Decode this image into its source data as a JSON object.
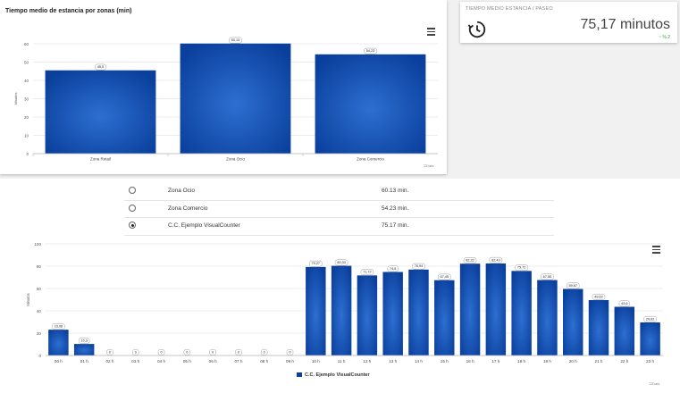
{
  "top_chart": {
    "title": "Tiempo medio de estancia por zonas (min)",
    "credits": "⎋Dats"
  },
  "kpi": {
    "title": "TIEMPO MEDIO ESTANCIA / PASEO",
    "value": "75,17 minutos",
    "change": "~ % 2",
    "icon": "clock-history-icon"
  },
  "selector": {
    "rows": [
      {
        "name": "Zona Ocio",
        "value": "60.13 min.",
        "checked": false
      },
      {
        "name": "Zona Comercio",
        "value": "54.23 min.",
        "checked": false
      },
      {
        "name": "C.C. Ejemplo VisualCounter",
        "value": "75.17 min.",
        "checked": true
      }
    ]
  },
  "bottom_chart": {
    "credits": "⎋Dats",
    "legend_label": "C.C. Ejemplo VisualCounter"
  },
  "colors": {
    "bar_edge": "#0a3f9c",
    "bar_center": "#2d6fd1",
    "grid": "#e6e6e6"
  },
  "chart_data": [
    {
      "type": "bar",
      "title": "Tiempo medio de estancia por zonas (min)",
      "ylabel": "Minutos",
      "categories": [
        "Zona Retail",
        "Zona Ocio",
        "Zona Comercio"
      ],
      "values": [
        45.5,
        60.13,
        54.23
      ],
      "data_labels": [
        "45,5",
        "60,13",
        "54,23"
      ],
      "ylim": [
        0,
        60
      ],
      "yticks": [
        0,
        10,
        20,
        30,
        40,
        50,
        60
      ],
      "grid": true
    },
    {
      "type": "bar",
      "ylabel": "Minutos",
      "categories": [
        "00 h",
        "01 h",
        "02 h",
        "03 h",
        "04 h",
        "05 h",
        "06 h",
        "07 h",
        "08 h",
        "09 h",
        "10 h",
        "11 h",
        "12 h",
        "13 h",
        "14 h",
        "15 h",
        "16 h",
        "17 h",
        "18 h",
        "19 h",
        "20 h",
        "21 h",
        "22 h",
        "23 h"
      ],
      "series": [
        {
          "name": "C.C. Ejemplo VisualCounter",
          "values": [
            23.08,
            10.3,
            0,
            0,
            0,
            0,
            0,
            0,
            0,
            0,
            79.27,
            80.33,
            71.72,
            74.8,
            76.94,
            67.45,
            82.22,
            82.43,
            75.72,
            67.55,
            59.57,
            49.62,
            43.6,
            29.62
          ],
          "data_labels": [
            "23,08",
            "10,3",
            "0",
            "0",
            "0",
            "0",
            "0",
            "0",
            "0",
            "0",
            "79,27",
            "80,33",
            "71,72",
            "74,8",
            "76,94",
            "67,45",
            "82,22",
            "82,43",
            "75,72",
            "67,55",
            "59,57",
            "49,62",
            "43,6",
            "29,62"
          ]
        }
      ],
      "ylim": [
        0,
        100
      ],
      "yticks": [
        0,
        20,
        40,
        60,
        80,
        100
      ],
      "grid": true,
      "legend": "bottom-center"
    }
  ]
}
